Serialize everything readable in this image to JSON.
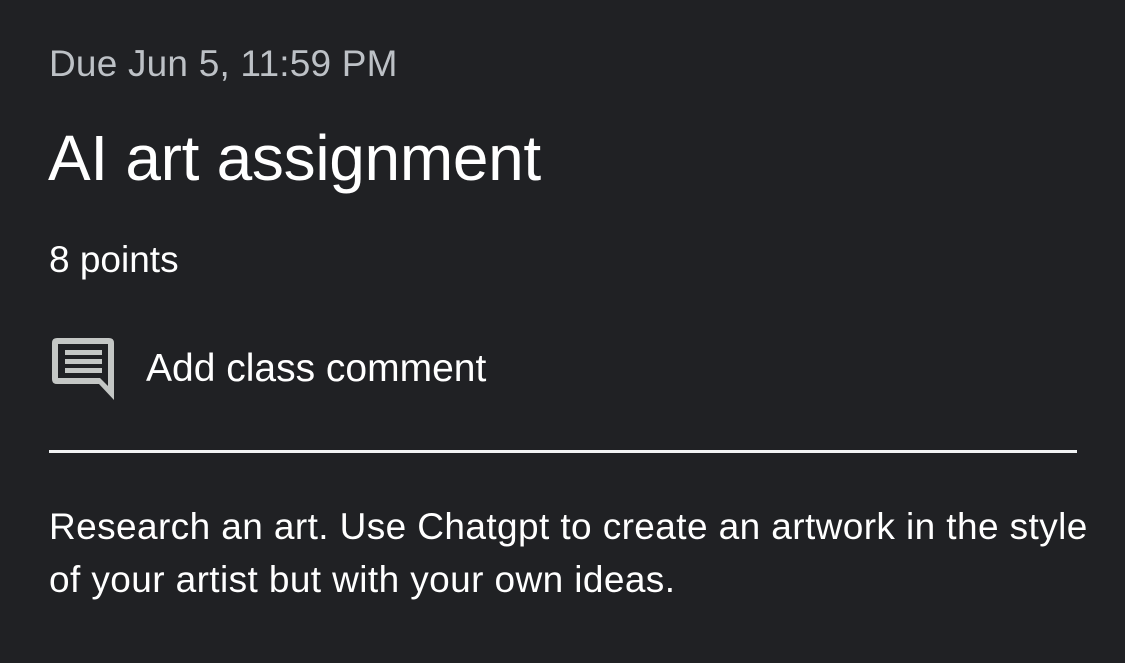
{
  "assignment": {
    "due": "Due Jun 5, 11:59 PM",
    "title": "AI art assignment",
    "points": "8 points",
    "class_comment": {
      "label": "Add class comment",
      "icon": "comment-icon"
    },
    "description": "Research an art. Use Chatgpt to create an artwork in the style of your artist but with your own ideas."
  },
  "colors": {
    "background": "#202124",
    "text": "#ffffff",
    "secondary_text": "#bdc1c6",
    "icon": "#c4c7c5",
    "divider": "#f1f3f4"
  }
}
